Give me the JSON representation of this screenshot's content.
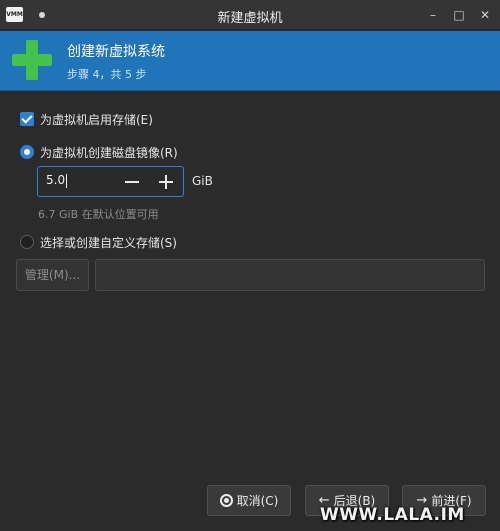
{
  "window": {
    "title": "新建虚拟机",
    "app_icon_text": "VMM",
    "minimize_glyph": "–",
    "maximize_glyph": "□",
    "close_glyph": "✕"
  },
  "banner": {
    "title": "创建新虚拟系统",
    "subtitle": "步骤 4，共 5 步",
    "icon": "plus-icon",
    "icon_color": "#46c24a",
    "background_color": "#1f74ba"
  },
  "storage": {
    "enable_label": "为虚拟机启用存储(E)",
    "enable_checked": true,
    "create_disk_label": "为虚拟机创建磁盘镜像(R)",
    "create_disk_selected": true,
    "size_value": "5.0",
    "size_unit": "GiB",
    "available_hint": "6.7 GiB 在默认位置可用",
    "custom_label": "选择或创建自定义存储(S)",
    "custom_selected": false,
    "manage_label": "管理(M)...",
    "path_value": ""
  },
  "buttons": {
    "cancel_label": "取消(C)",
    "back_label": "后退(B)",
    "back_icon": "←",
    "forward_label": "前进(F)",
    "forward_icon": "→"
  },
  "watermark": "WWW.LALA.IM",
  "colors": {
    "accent": "#2f80d1",
    "background": "#2b2b2b"
  }
}
